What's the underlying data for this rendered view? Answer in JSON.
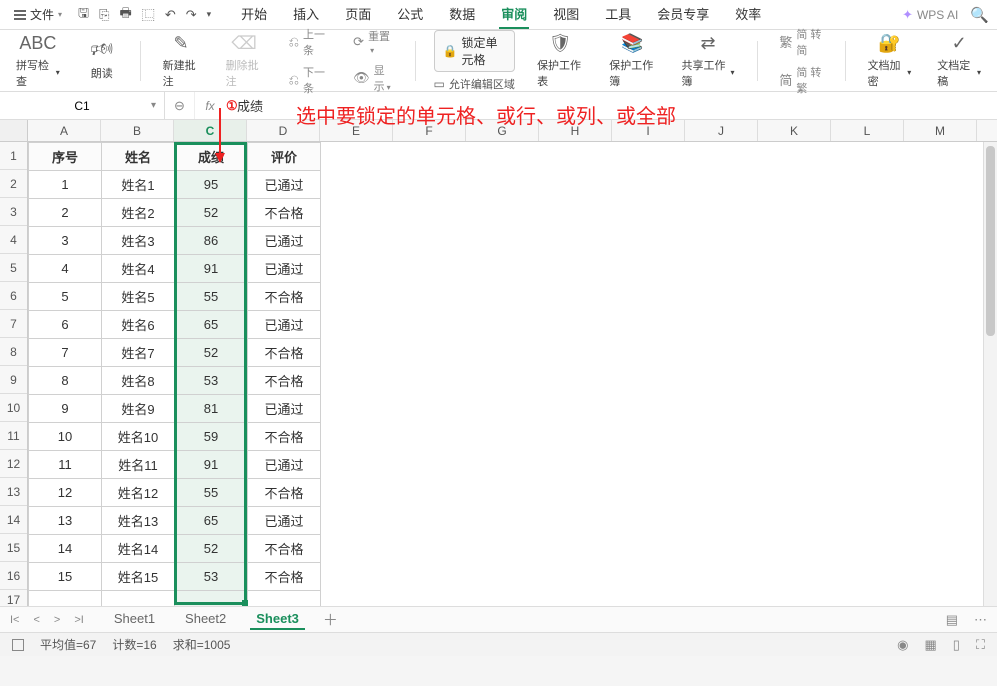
{
  "menu": {
    "file": "文件",
    "tabs": [
      "开始",
      "插入",
      "页面",
      "公式",
      "数据",
      "审阅",
      "视图",
      "工具",
      "会员专享",
      "效率"
    ],
    "active": 5,
    "wpsai": "WPS AI"
  },
  "ribbon": {
    "spellcheck": "拼写检查",
    "read": "朗读",
    "newcomment": "新建批注",
    "delcomment": "删除批注",
    "prev": "上一条",
    "next": "下一条",
    "reset": "重置",
    "show": "显示",
    "lockcell": "锁定单元格",
    "allowedit": "允许编辑区域",
    "protectsheet": "保护工作表",
    "protectbook": "保护工作簿",
    "sharebook": "共享工作簿",
    "simp": "简 转简",
    "trad": "简 转繁",
    "encrypt": "文档加密",
    "finalize": "文档定稿"
  },
  "annot": {
    "badge": "①",
    "text": "选中要锁定的单元格、或行、或列、或全部"
  },
  "fx": {
    "name": "C1",
    "value": "成绩"
  },
  "cols": [
    "A",
    "B",
    "C",
    "D",
    "E",
    "F",
    "G",
    "H",
    "I",
    "J",
    "K",
    "L",
    "M"
  ],
  "rowcount": 17,
  "table": {
    "headers": [
      "序号",
      "姓名",
      "成绩",
      "评价"
    ],
    "rows": [
      [
        "1",
        "姓名1",
        "95",
        "已通过"
      ],
      [
        "2",
        "姓名2",
        "52",
        "不合格"
      ],
      [
        "3",
        "姓名3",
        "86",
        "已通过"
      ],
      [
        "4",
        "姓名4",
        "91",
        "已通过"
      ],
      [
        "5",
        "姓名5",
        "55",
        "不合格"
      ],
      [
        "6",
        "姓名6",
        "65",
        "已通过"
      ],
      [
        "7",
        "姓名7",
        "52",
        "不合格"
      ],
      [
        "8",
        "姓名8",
        "53",
        "不合格"
      ],
      [
        "9",
        "姓名9",
        "81",
        "已通过"
      ],
      [
        "10",
        "姓名10",
        "59",
        "不合格"
      ],
      [
        "11",
        "姓名11",
        "91",
        "已通过"
      ],
      [
        "12",
        "姓名12",
        "55",
        "不合格"
      ],
      [
        "13",
        "姓名13",
        "65",
        "已通过"
      ],
      [
        "14",
        "姓名14",
        "52",
        "不合格"
      ],
      [
        "15",
        "姓名15",
        "53",
        "不合格"
      ]
    ]
  },
  "sheets": {
    "list": [
      "Sheet1",
      "Sheet2",
      "Sheet3"
    ],
    "active": 2
  },
  "status": {
    "avg": "平均值=67",
    "count": "计数=16",
    "sum": "求和=1005"
  }
}
